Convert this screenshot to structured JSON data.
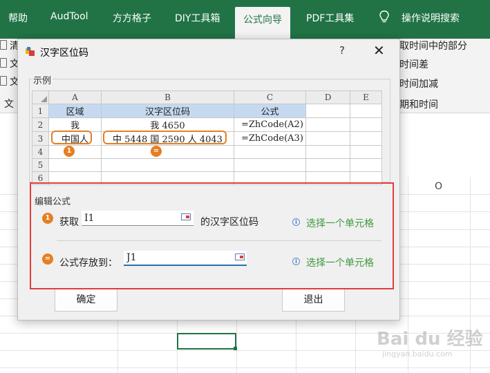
{
  "ribbon": {
    "tabs": [
      "帮助",
      "AudTool",
      "方方格子",
      "DIY工具箱",
      "公式向导",
      "PDF工具集",
      "操作说明搜索"
    ],
    "active_tab": "公式向导",
    "left_items": [
      "清",
      "文",
      "文",
      "文"
    ],
    "right_items": [
      "取时间中的部分",
      "时间差",
      "时间加减",
      "期和时间"
    ]
  },
  "sheet": {
    "visible_column_letter": "O"
  },
  "dialog": {
    "title": "汉字区位码",
    "help": "?",
    "close": "✕",
    "example_group": "示例",
    "example_grid": {
      "col_headers": [
        "A",
        "B",
        "C",
        "D",
        "E"
      ],
      "rows": [
        {
          "n": "1",
          "cells": [
            "区域",
            "汉字区位码",
            "公式",
            "",
            ""
          ]
        },
        {
          "n": "2",
          "cells": [
            "我",
            "我 4650",
            "=ZhCode(A2)",
            "",
            ""
          ]
        },
        {
          "n": "3",
          "cells": [
            "中国人",
            "中 5448 国 2590 人 4043",
            "=ZhCode(A3)",
            "",
            ""
          ]
        },
        {
          "n": "4",
          "cells": [
            "",
            "",
            "",
            "",
            ""
          ]
        },
        {
          "n": "5",
          "cells": [
            "",
            "",
            "",
            "",
            ""
          ]
        },
        {
          "n": "6",
          "cells": [
            "",
            "",
            "",
            "",
            ""
          ]
        }
      ]
    },
    "badges": {
      "one": "1",
      "two": "="
    },
    "edit_group": "编辑公式",
    "row1": {
      "label": "获取",
      "value": "I1",
      "suffix": "的汉字区位码",
      "link": "选择一个单元格"
    },
    "row2": {
      "label": "公式存放到：",
      "value": "J1",
      "link": "选择一个单元格"
    },
    "ok_button": "确定",
    "exit_button": "退出"
  },
  "watermark": {
    "big": "Bai du 经验",
    "small": "jingyan.baidu.com"
  },
  "colors": {
    "excel_green": "#217346",
    "highlight_orange": "#e67e22",
    "red_frame": "#e03c3c",
    "link_green": "#3d9a3d",
    "header_blue": "#c5daf1"
  }
}
